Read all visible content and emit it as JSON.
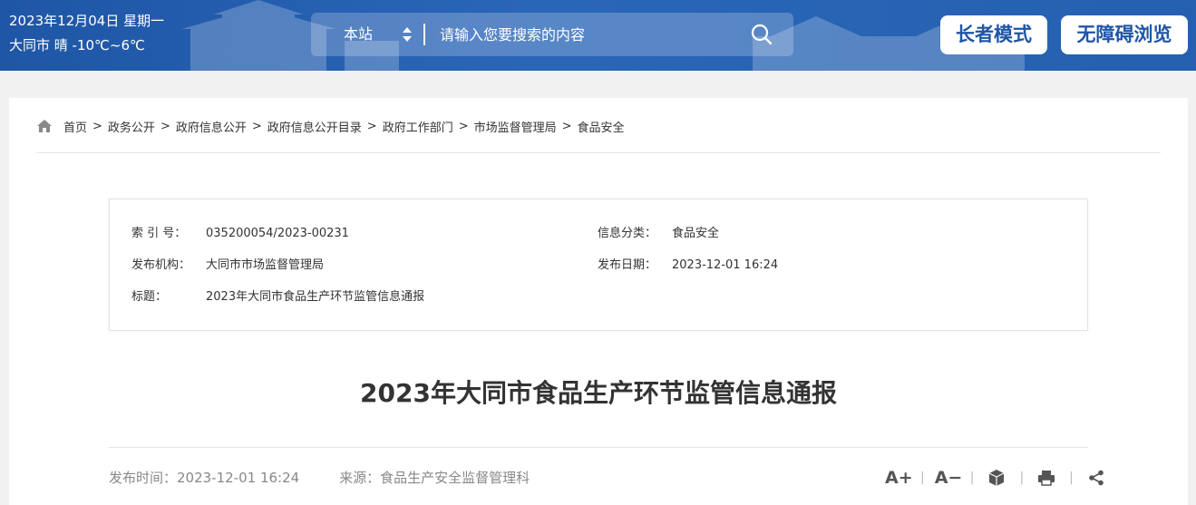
{
  "header": {
    "date_line": "2023年12月04日 星期一",
    "weather_line": "大同市 晴 -10℃~6℃",
    "search": {
      "scope": "本站",
      "placeholder": "请输入您要搜索的内容"
    },
    "elder_mode": "长者模式",
    "accessible_mode": "无障碍浏览",
    "colors": {
      "header_bg": "#2560b0",
      "button_text": "#1f56a6"
    }
  },
  "breadcrumb": {
    "items": [
      "首页",
      "政务公开",
      "政府信息公开",
      "政府信息公开目录",
      "政府工作部门",
      "市场监督管理局",
      "食品安全"
    ],
    "separator": ">"
  },
  "info": {
    "index_label": "索 引 号：",
    "index_value": "035200054/2023-00231",
    "category_label": "信息分类：",
    "category_value": "食品安全",
    "publisher_label": "发布机构：",
    "publisher_value": "大同市市场监督管理局",
    "date_label": "发布日期：",
    "date_value": "2023-12-01 16:24",
    "title_label": "标题：",
    "title_value": "2023年大同市食品生产环节监管信息通报"
  },
  "article": {
    "title": "2023年大同市食品生产环节监管信息通报",
    "publish_time": "发布时间：2023-12-01 16:24",
    "source": "来源：食品生产安全监督管理科",
    "tools": {
      "font_larger": "A+",
      "font_smaller": "A−",
      "icons": [
        "cube-icon",
        "print-icon",
        "share-icon"
      ]
    }
  }
}
